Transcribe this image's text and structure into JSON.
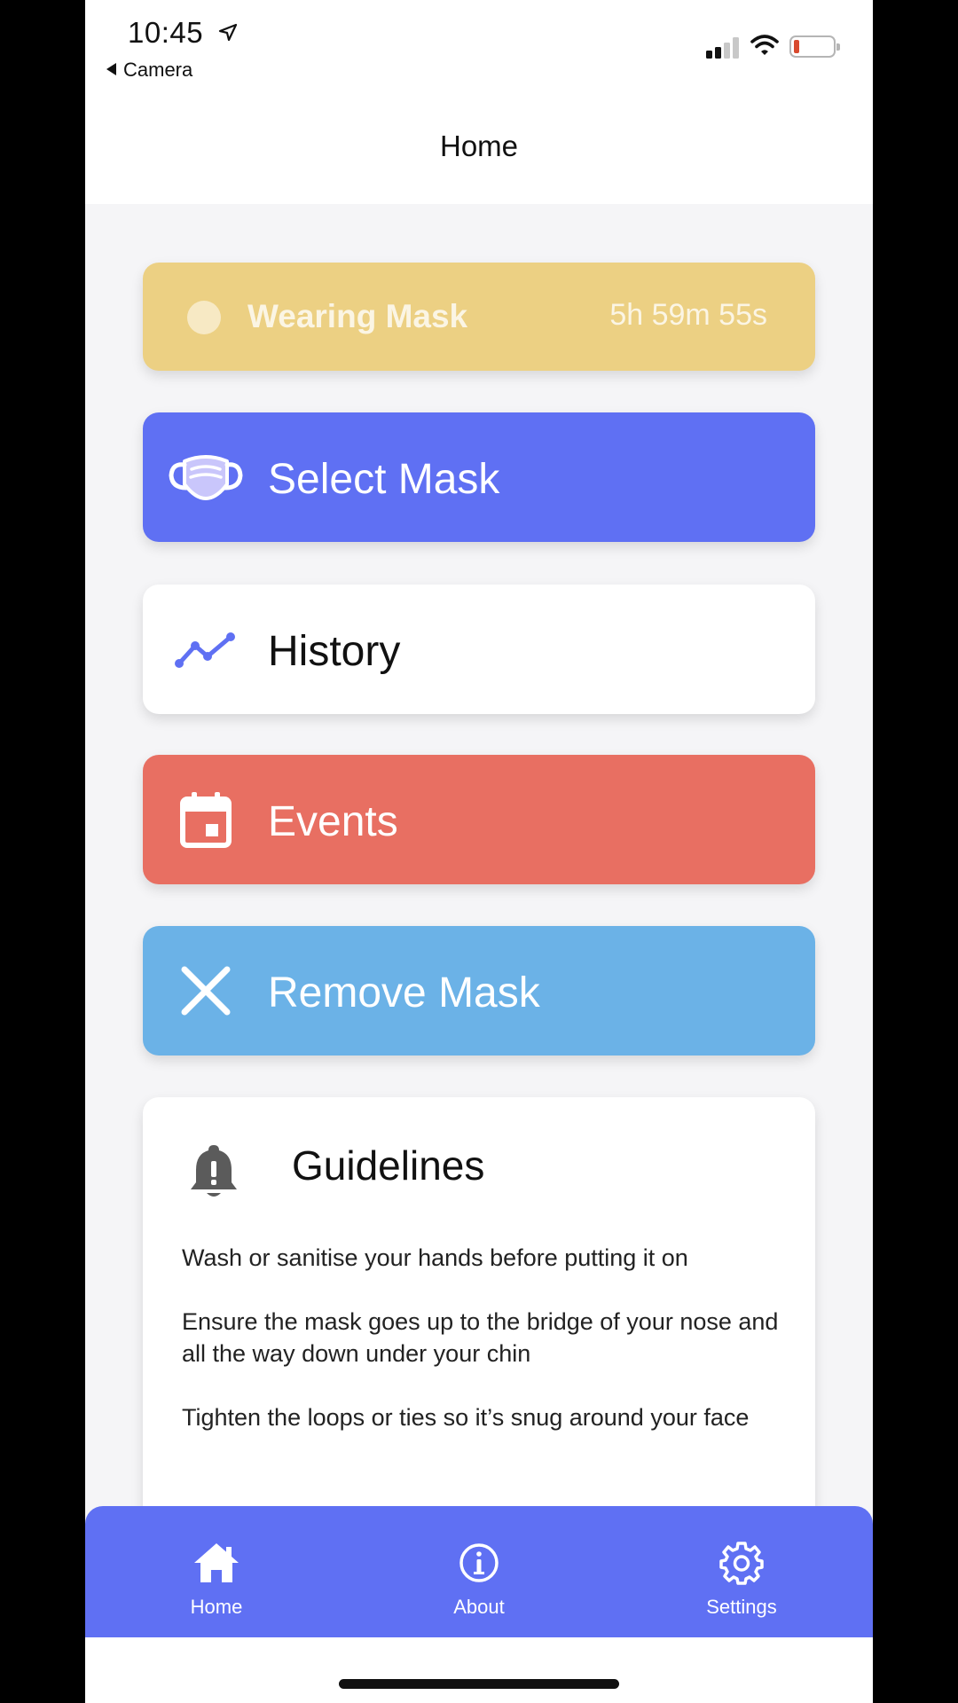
{
  "status_bar": {
    "time": "10:45",
    "back_app": "Camera"
  },
  "header": {
    "title": "Home"
  },
  "mask_status": {
    "label": "Wearing Mask",
    "timer": "5h 59m 55s"
  },
  "actions": [
    {
      "label": "Select Mask",
      "icon": "mask-icon"
    },
    {
      "label": "History",
      "icon": "trend-line-icon"
    },
    {
      "label": "Events",
      "icon": "calendar-icon"
    },
    {
      "label": "Remove Mask",
      "icon": "close-icon"
    }
  ],
  "guidelines": {
    "title": "Guidelines",
    "icon": "bell-alert-icon",
    "items": [
      "Wash or sanitise your hands before putting it on",
      "Ensure the mask goes up to the bridge of your nose and all the way down under your chin",
      "Tighten the loops or ties so it’s snug around your face"
    ]
  },
  "tabbar": {
    "tabs": [
      {
        "label": "Home",
        "icon": "home-icon"
      },
      {
        "label": "About",
        "icon": "info-icon"
      },
      {
        "label": "Settings",
        "icon": "gear-icon"
      }
    ]
  },
  "colors": {
    "primary": "#5f70f3",
    "wearing": "#ecd083",
    "events": "#e86f62",
    "remove": "#6bb2e7",
    "background": "#f5f5f7"
  }
}
